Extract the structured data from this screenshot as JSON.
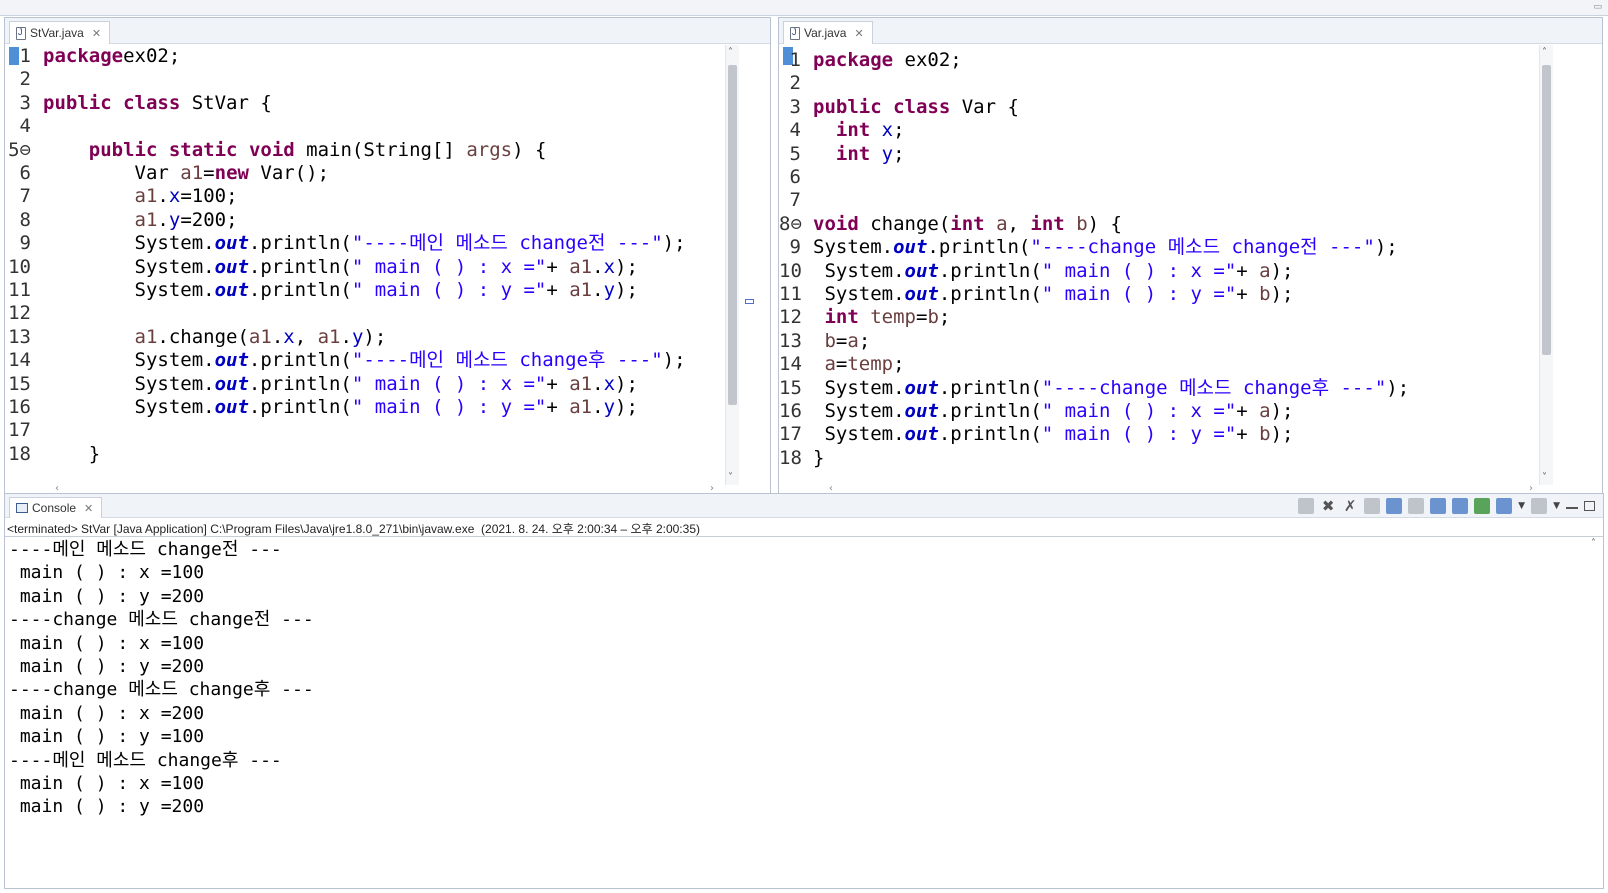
{
  "colors": {
    "keyword": "#7f0055",
    "string": "#2a00ff",
    "field": "#0000c0",
    "static_field": "#0000c0",
    "accent": "#4f8fd8"
  },
  "editors": {
    "left": {
      "tab_label": "StVar.java",
      "lines": [
        {
          "n": "1",
          "t": [
            [
              "kw",
              "package"
            ],
            [
              "",
              "ex02;"
            ]
          ]
        },
        {
          "n": "2",
          "t": []
        },
        {
          "n": "3",
          "t": [
            [
              "kw",
              "public"
            ],
            [
              "",
              " "
            ],
            [
              "kw",
              "class"
            ],
            [
              "",
              " StVar {"
            ]
          ]
        },
        {
          "n": "4",
          "t": []
        },
        {
          "n": "5⊖",
          "t": [
            [
              "",
              "    "
            ],
            [
              "kw",
              "public"
            ],
            [
              "",
              " "
            ],
            [
              "kw",
              "static"
            ],
            [
              "",
              " "
            ],
            [
              "kw",
              "void"
            ],
            [
              "",
              " main(String[] "
            ],
            [
              "param",
              "args"
            ],
            [
              "",
              ") {"
            ]
          ]
        },
        {
          "n": "6",
          "t": [
            [
              "",
              "        Var "
            ],
            [
              "param",
              "a1"
            ],
            [
              "",
              "="
            ],
            [
              "kw",
              "new"
            ],
            [
              "",
              " Var();"
            ]
          ]
        },
        {
          "n": "7",
          "t": [
            [
              "",
              "        "
            ],
            [
              "param",
              "a1"
            ],
            [
              "",
              "."
            ],
            [
              "field",
              "x"
            ],
            [
              "",
              "=100;"
            ]
          ]
        },
        {
          "n": "8",
          "t": [
            [
              "",
              "        "
            ],
            [
              "param",
              "a1"
            ],
            [
              "",
              "."
            ],
            [
              "field",
              "y"
            ],
            [
              "",
              "=200;"
            ]
          ]
        },
        {
          "n": "9",
          "t": [
            [
              "",
              "        System."
            ],
            [
              "static",
              "out"
            ],
            [
              "",
              ".println("
            ],
            [
              "str",
              "\"----메인 메소드 change전 ---\""
            ],
            [
              "",
              ");"
            ]
          ]
        },
        {
          "n": "10",
          "t": [
            [
              "",
              "        System."
            ],
            [
              "static",
              "out"
            ],
            [
              "",
              ".println("
            ],
            [
              "str",
              "\" main ( ) : x =\""
            ],
            [
              "",
              "+ "
            ],
            [
              "param",
              "a1"
            ],
            [
              "",
              "."
            ],
            [
              "field",
              "x"
            ],
            [
              "",
              ");"
            ]
          ]
        },
        {
          "n": "11",
          "t": [
            [
              "",
              "        System."
            ],
            [
              "static",
              "out"
            ],
            [
              "",
              ".println("
            ],
            [
              "str",
              "\" main ( ) : y =\""
            ],
            [
              "",
              "+ "
            ],
            [
              "param",
              "a1"
            ],
            [
              "",
              "."
            ],
            [
              "field",
              "y"
            ],
            [
              "",
              ");"
            ]
          ]
        },
        {
          "n": "12",
          "t": []
        },
        {
          "n": "13",
          "t": [
            [
              "",
              "        "
            ],
            [
              "param",
              "a1"
            ],
            [
              "",
              ".change("
            ],
            [
              "param",
              "a1"
            ],
            [
              "",
              "."
            ],
            [
              "field",
              "x"
            ],
            [
              "",
              ", "
            ],
            [
              "param",
              "a1"
            ],
            [
              "",
              "."
            ],
            [
              "field",
              "y"
            ],
            [
              "",
              ");"
            ]
          ]
        },
        {
          "n": "14",
          "t": [
            [
              "",
              "        System."
            ],
            [
              "static",
              "out"
            ],
            [
              "",
              ".println("
            ],
            [
              "str",
              "\"----메인 메소드 change후 ---\""
            ],
            [
              "",
              ");"
            ]
          ]
        },
        {
          "n": "15",
          "t": [
            [
              "",
              "        System."
            ],
            [
              "static",
              "out"
            ],
            [
              "",
              ".println("
            ],
            [
              "str",
              "\" main ( ) : x =\""
            ],
            [
              "",
              "+ "
            ],
            [
              "param",
              "a1"
            ],
            [
              "",
              "."
            ],
            [
              "field",
              "x"
            ],
            [
              "",
              ");"
            ]
          ]
        },
        {
          "n": "16",
          "t": [
            [
              "",
              "        System."
            ],
            [
              "static",
              "out"
            ],
            [
              "",
              ".println("
            ],
            [
              "str",
              "\" main ( ) : y =\""
            ],
            [
              "",
              "+ "
            ],
            [
              "param",
              "a1"
            ],
            [
              "",
              "."
            ],
            [
              "field",
              "y"
            ],
            [
              "",
              ");"
            ]
          ]
        },
        {
          "n": "17",
          "t": []
        },
        {
          "n": "18",
          "t": [
            [
              "",
              "    }"
            ]
          ]
        }
      ]
    },
    "right": {
      "tab_label": "Var.java",
      "lines": [
        {
          "n": "1",
          "t": [
            [
              "kw",
              "package"
            ],
            [
              "",
              " ex02;"
            ]
          ]
        },
        {
          "n": "2",
          "t": []
        },
        {
          "n": "3",
          "t": [
            [
              "kw",
              "public"
            ],
            [
              "",
              " "
            ],
            [
              "kw",
              "class"
            ],
            [
              "",
              " Var {"
            ]
          ]
        },
        {
          "n": "4",
          "t": [
            [
              "",
              "  "
            ],
            [
              "kw",
              "int"
            ],
            [
              "",
              " "
            ],
            [
              "field",
              "x"
            ],
            [
              "",
              ";"
            ]
          ]
        },
        {
          "n": "5",
          "t": [
            [
              "",
              "  "
            ],
            [
              "kw",
              "int"
            ],
            [
              "",
              " "
            ],
            [
              "field",
              "y"
            ],
            [
              "",
              ";"
            ]
          ]
        },
        {
          "n": "6",
          "t": []
        },
        {
          "n": "7",
          "t": []
        },
        {
          "n": "8⊖",
          "t": [
            [
              "kw",
              "void"
            ],
            [
              "",
              " change("
            ],
            [
              "kw",
              "int"
            ],
            [
              "",
              " "
            ],
            [
              "param",
              "a"
            ],
            [
              "",
              ", "
            ],
            [
              "kw",
              "int"
            ],
            [
              "",
              " "
            ],
            [
              "param",
              "b"
            ],
            [
              "",
              ") {"
            ]
          ]
        },
        {
          "n": "9",
          "t": [
            [
              "",
              "System."
            ],
            [
              "static",
              "out"
            ],
            [
              "",
              ".println("
            ],
            [
              "str",
              "\"----change 메소드 change전 ---\""
            ],
            [
              "",
              ");"
            ]
          ]
        },
        {
          "n": "10",
          "t": [
            [
              "",
              " System."
            ],
            [
              "static",
              "out"
            ],
            [
              "",
              ".println("
            ],
            [
              "str",
              "\" main ( ) : x =\""
            ],
            [
              "",
              "+ "
            ],
            [
              "param",
              "a"
            ],
            [
              "",
              ");"
            ]
          ]
        },
        {
          "n": "11",
          "t": [
            [
              "",
              " System."
            ],
            [
              "static",
              "out"
            ],
            [
              "",
              ".println("
            ],
            [
              "str",
              "\" main ( ) : y =\""
            ],
            [
              "",
              "+ "
            ],
            [
              "param",
              "b"
            ],
            [
              "",
              ");"
            ]
          ]
        },
        {
          "n": "12",
          "t": [
            [
              "",
              " "
            ],
            [
              "kw",
              "int"
            ],
            [
              "",
              " "
            ],
            [
              "param",
              "temp"
            ],
            [
              "",
              "="
            ],
            [
              "param",
              "b"
            ],
            [
              "",
              ";"
            ]
          ]
        },
        {
          "n": "13",
          "t": [
            [
              "",
              " "
            ],
            [
              "param",
              "b"
            ],
            [
              "",
              "="
            ],
            [
              "param",
              "a"
            ],
            [
              "",
              ";"
            ]
          ]
        },
        {
          "n": "14",
          "t": [
            [
              "",
              " "
            ],
            [
              "param",
              "a"
            ],
            [
              "",
              "="
            ],
            [
              "param",
              "temp"
            ],
            [
              "",
              ";"
            ]
          ]
        },
        {
          "n": "15",
          "t": [
            [
              "",
              " System."
            ],
            [
              "static",
              "out"
            ],
            [
              "",
              ".println("
            ],
            [
              "str",
              "\"----change 메소드 change후 ---\""
            ],
            [
              "",
              ");"
            ]
          ]
        },
        {
          "n": "16",
          "t": [
            [
              "",
              " System."
            ],
            [
              "static",
              "out"
            ],
            [
              "",
              ".println("
            ],
            [
              "str",
              "\" main ( ) : x =\""
            ],
            [
              "",
              "+ "
            ],
            [
              "param",
              "a"
            ],
            [
              "",
              ");"
            ]
          ]
        },
        {
          "n": "17",
          "t": [
            [
              "",
              " System."
            ],
            [
              "static",
              "out"
            ],
            [
              "",
              ".println("
            ],
            [
              "str",
              "\" main ( ) : y =\""
            ],
            [
              "",
              "+ "
            ],
            [
              "param",
              "b"
            ],
            [
              "",
              ");"
            ]
          ]
        },
        {
          "n": "18",
          "t": [
            [
              "",
              "}"
            ]
          ]
        }
      ]
    }
  },
  "console": {
    "tab_label": "Console",
    "status": "<terminated> StVar [Java Application] C:\\Program Files\\Java\\jre1.8.0_271\\bin\\javaw.exe  (2021. 8. 24. 오후 2:00:34 – 오후 2:00:35)",
    "output": [
      "----메인 메소드 change전 ---",
      " main ( ) : x =100",
      " main ( ) : y =200",
      "----change 메소드 change전 ---",
      " main ( ) : x =100",
      " main ( ) : y =200",
      "----change 메소드 change후 ---",
      " main ( ) : x =200",
      " main ( ) : y =100",
      "----메인 메소드 change후 ---",
      " main ( ) : x =100",
      " main ( ) : y =200"
    ],
    "toolbar_icons": [
      "terminate-icon",
      "remove-launch-icon",
      "remove-all-terminated-icon",
      "clear-console-icon",
      "scroll-lock-icon",
      "word-wrap-icon",
      "show-on-stdout-icon",
      "show-on-stderr-icon",
      "pin-console-icon",
      "display-selected-console-icon",
      "open-console-icon",
      "minimize-icon",
      "maximize-icon"
    ]
  }
}
